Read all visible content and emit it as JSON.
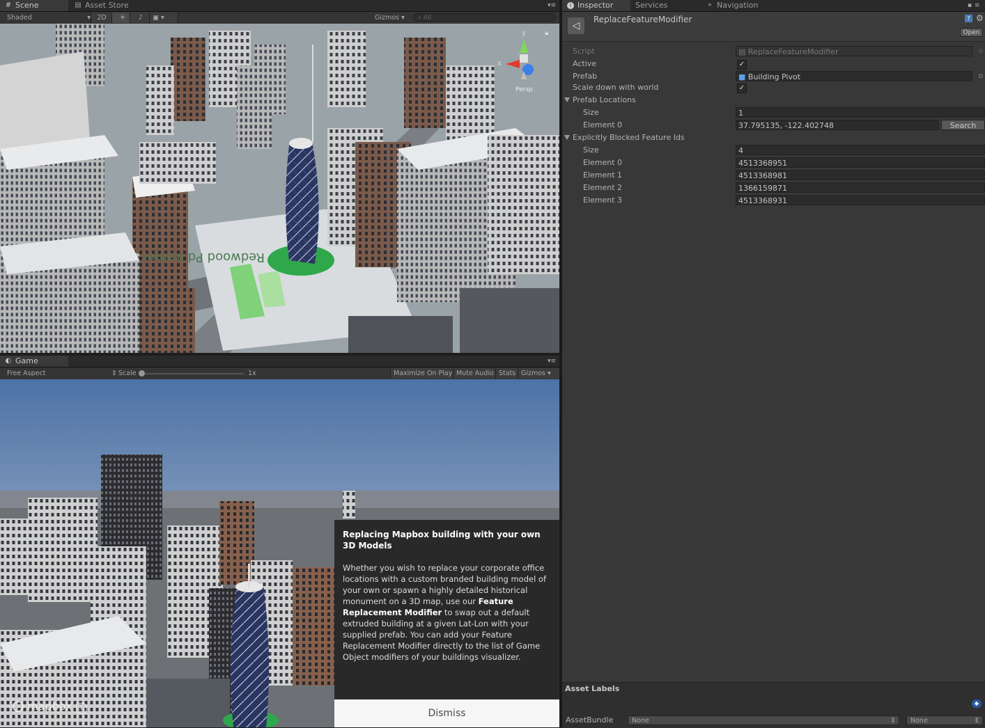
{
  "scene_panel": {
    "tabs": [
      {
        "label": "Scene",
        "icon": "grid-icon"
      },
      {
        "label": "Asset Store",
        "icon": "bag-icon"
      }
    ],
    "toolbar": {
      "draw_mode": "Shaded",
      "mode_2d": "2D",
      "gizmos": "Gizmos",
      "search_placeholder": "All"
    },
    "gizmo_axes": {
      "y": "y",
      "x": "x"
    },
    "persp_label": "Persp",
    "street_text": "Redwood Pd Iramer"
  },
  "game_panel": {
    "tab": {
      "label": "Game",
      "icon": "pacman-icon"
    },
    "toolbar": {
      "aspect": "Free Aspect",
      "scale_label": "Scale",
      "scale_value": "1x",
      "maximize": "Maximize On Play",
      "mute": "Mute Audio",
      "stats": "Stats",
      "gizmos": "Gizmos"
    },
    "info": {
      "title": "Replacing Mapbox building with your own 3D Models",
      "body_1": "Whether you wish to replace your corporate office locations with a custom branded building model of your own or spawn a highly detailed historical monument on a 3D map, use our ",
      "body_bold": "Feature Replacement Modifier",
      "body_2": " to swap out a default extruded building at a given Lat-Lon with your supplied prefab. You can add your Feature Replacement Modifier directly to the list of Game Object modifiers of your buildings visualizer.",
      "dismiss": "Dismiss"
    },
    "logo": "mapbox"
  },
  "inspector": {
    "tabs": [
      {
        "label": "Inspector",
        "icon": "info-icon"
      },
      {
        "label": "Services",
        "icon": ""
      },
      {
        "label": "Navigation",
        "icon": "navigation-icon"
      }
    ],
    "object_name": "ReplaceFeatureModifier",
    "open_button": "Open",
    "rows": {
      "script": {
        "label": "Script",
        "value": "ReplaceFeatureModifier"
      },
      "active": {
        "label": "Active",
        "checked": true
      },
      "prefab": {
        "label": "Prefab",
        "value": "Building Pivot"
      },
      "scale": {
        "label": "Scale down with world",
        "checked": true
      },
      "prefab_locations": {
        "label": "Prefab Locations",
        "size_label": "Size",
        "size": "1",
        "elements": [
          {
            "label": "Element 0",
            "value": "37.795135, -122.402748"
          }
        ],
        "search_button": "Search"
      },
      "blocked": {
        "label": "Explicitly Blocked Feature Ids",
        "size_label": "Size",
        "size": "4",
        "elements": [
          {
            "label": "Element 0",
            "value": "4513368951"
          },
          {
            "label": "Element 1",
            "value": "4513368981"
          },
          {
            "label": "Element 2",
            "value": "1366159871"
          },
          {
            "label": "Element 3",
            "value": "4513368931"
          }
        ]
      }
    },
    "asset_labels": "Asset Labels",
    "asset_bundle": {
      "label": "AssetBundle",
      "value1": "None",
      "value2": "None"
    }
  }
}
